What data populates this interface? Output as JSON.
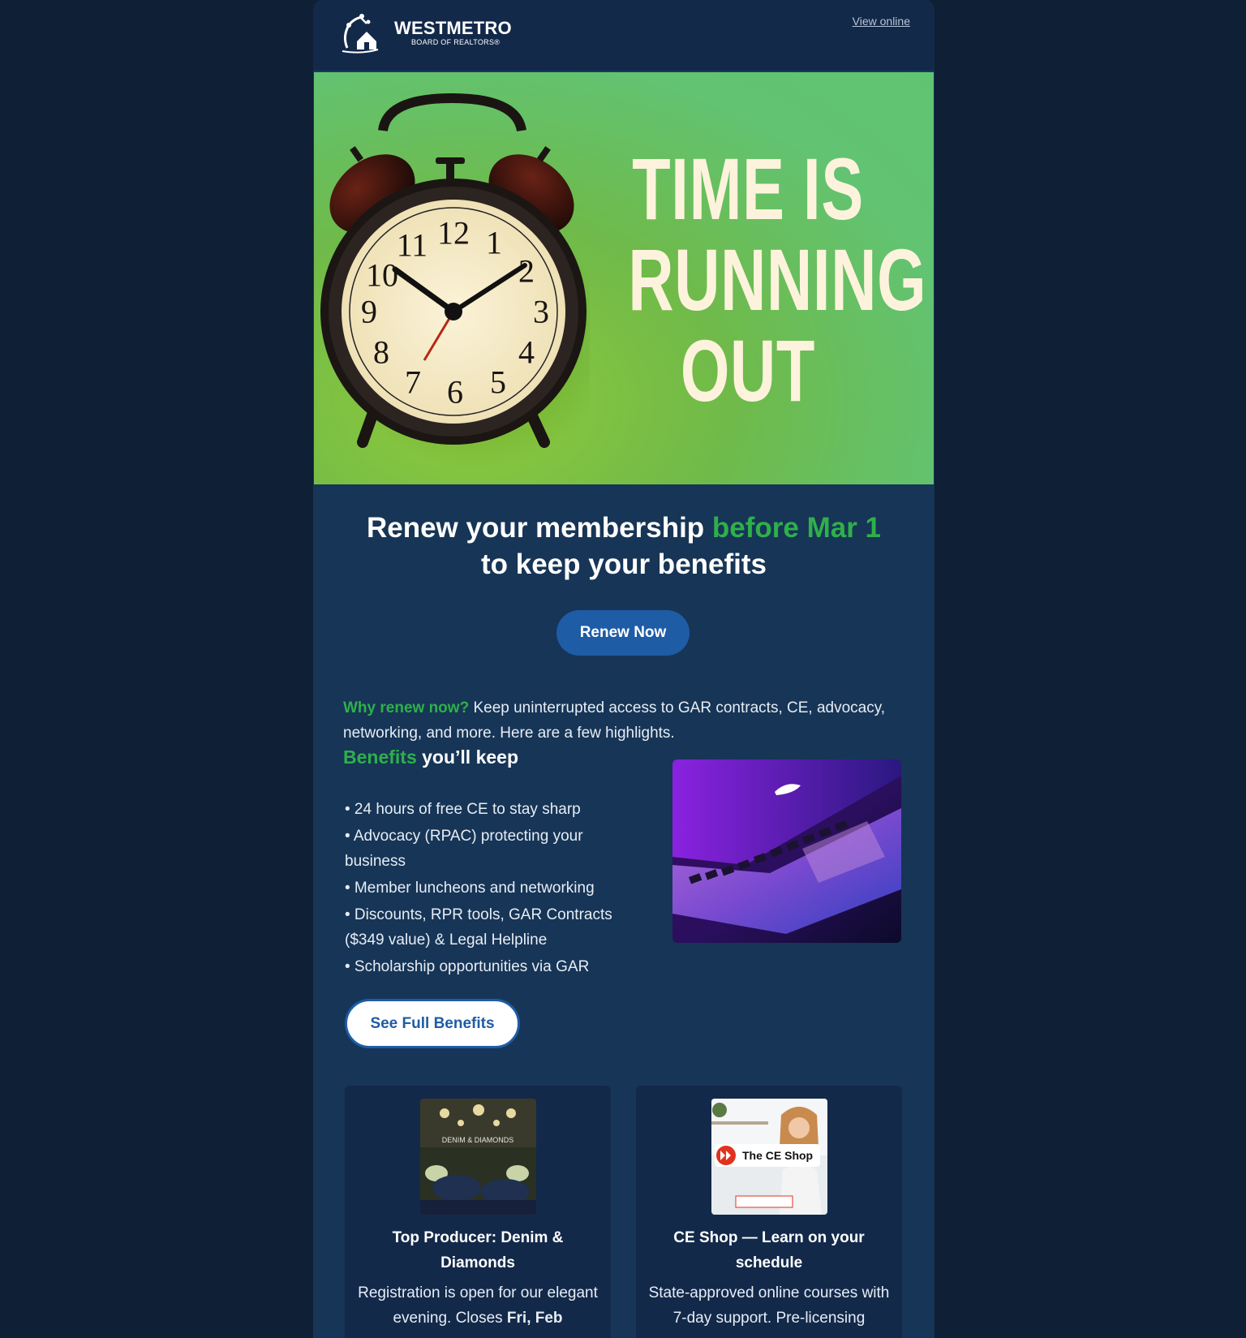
{
  "header": {
    "logo_name": "WESTMETRO",
    "logo_sub": "BOARD OF REALTORS®",
    "view_online": "View online"
  },
  "hero": {
    "line1": "TIME IS",
    "line2": "RUNNING",
    "line3": "OUT",
    "clock_numerals": [
      "12",
      "1",
      "2",
      "3",
      "4",
      "5",
      "6",
      "7",
      "8",
      "9",
      "10",
      "11"
    ]
  },
  "headline": {
    "part1": "Renew your membership ",
    "highlight": "before Mar 1",
    "part2": "to keep your benefits"
  },
  "renew_button": "Renew Now",
  "why": {
    "lead": "Why renew now?",
    "text": " Keep uninterrupted access to GAR contracts, CE, advocacy, networking, and more. Here are a few highlights."
  },
  "benefits": {
    "title_highlight": "Benefits",
    "title_rest": " you’ll keep",
    "items": [
      "• 24 hours of free CE to stay sharp",
      "• Advocacy (RPAC) protecting your business",
      "• Member luncheons and networking",
      "• Discounts, RPR tools, GAR Contracts ($349 value) & Legal Helpline",
      "• Scholarship opportunities via GAR"
    ],
    "button": "See Full Benefits"
  },
  "cards": [
    {
      "image_text": "DENIM & DIAMONDS",
      "title": "Top Producer: Denim & Diamonds",
      "text": "Registration is open for our elegant evening. Closes ",
      "text_bold": "Fri, Feb"
    },
    {
      "image_text": "The CE Shop",
      "title": "CE Shop — Learn on your schedule",
      "text": "State-approved online courses with 7-day support. Pre-licensing"
    }
  ],
  "colors": {
    "page_bg": "#0f1f36",
    "email_bg": "#173556",
    "header_bg": "#13294a",
    "accent_green": "#2eb04a",
    "button_blue": "#1f5ca6",
    "hero_text": "#fdf3dc"
  }
}
